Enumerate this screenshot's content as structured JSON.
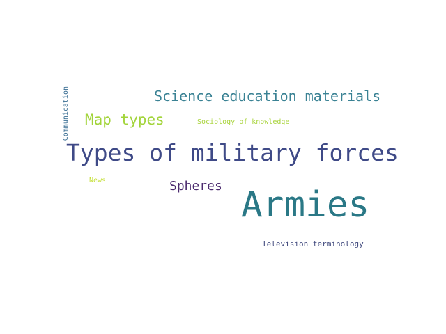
{
  "words": [
    {
      "text": "Armies",
      "color": "#2a7886"
    },
    {
      "text": "Types of military forces",
      "color": "#3f4a87"
    },
    {
      "text": "Science education materials",
      "color": "#3a8294"
    },
    {
      "text": "Map types",
      "color": "#a2d43a"
    },
    {
      "text": "Spheres",
      "color": "#4b2a6e"
    },
    {
      "text": "Sociology of knowledge",
      "color": "#a9d43c"
    },
    {
      "text": "News",
      "color": "#c4df35"
    },
    {
      "text": "Television terminology",
      "color": "#414a7e"
    },
    {
      "text": "Communication",
      "color": "#3b6f94"
    }
  ]
}
